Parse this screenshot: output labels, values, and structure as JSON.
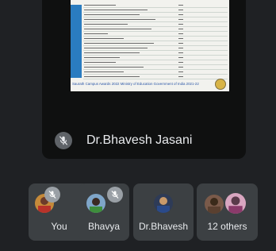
{
  "main_tile": {
    "speaker_name": "Dr.Bhavesh Jasani",
    "shared_doc_footer": "Saurath Campus Awards 2022 Ministry of Education Government of India 2021-22"
  },
  "participants": [
    {
      "label": "You",
      "muted": true,
      "icon": "avatar-photo"
    },
    {
      "label": "Bhavya",
      "muted": true,
      "icon": "avatar-photo"
    },
    {
      "label": "Dr.Bhavesh",
      "muted": false,
      "icon": "avatar-photo"
    },
    {
      "label": "12 others",
      "muted": false,
      "icon": "avatar-group"
    }
  ],
  "colors": {
    "background": "#1f2124",
    "tile": "#3c4043",
    "muted_icon_bg": "#5f6368"
  }
}
